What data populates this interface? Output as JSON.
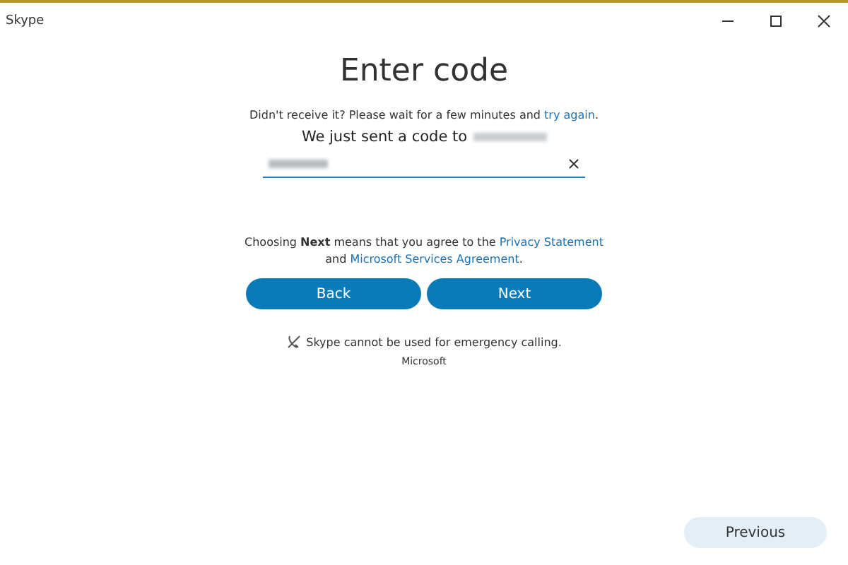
{
  "window": {
    "title": "Skype"
  },
  "heading": "Enter code",
  "resend_note": [
    {
      "kind": "text",
      "text": "Didn't receive it? Please wait for a few minutes and "
    },
    {
      "kind": "link",
      "text": "try again"
    },
    {
      "kind": "text",
      "text": "."
    }
  ],
  "sent_note": "We just sent a code to",
  "consent": [
    {
      "kind": "text",
      "text": "Choosing **Next** means that you agree to the "
    },
    {
      "kind": "link",
      "text": "Privacy Statement"
    },
    {
      "kind": "text",
      "text": " and "
    },
    {
      "kind": "link",
      "text": "Microsoft Services Agreement"
    },
    {
      "kind": "text",
      "text": "."
    }
  ],
  "buttons": [
    "Back",
    "Next"
  ],
  "emergency_note": "Skype cannot be used for emergency calling.",
  "footer": "Microsoft",
  "previous_button": "Previous"
}
